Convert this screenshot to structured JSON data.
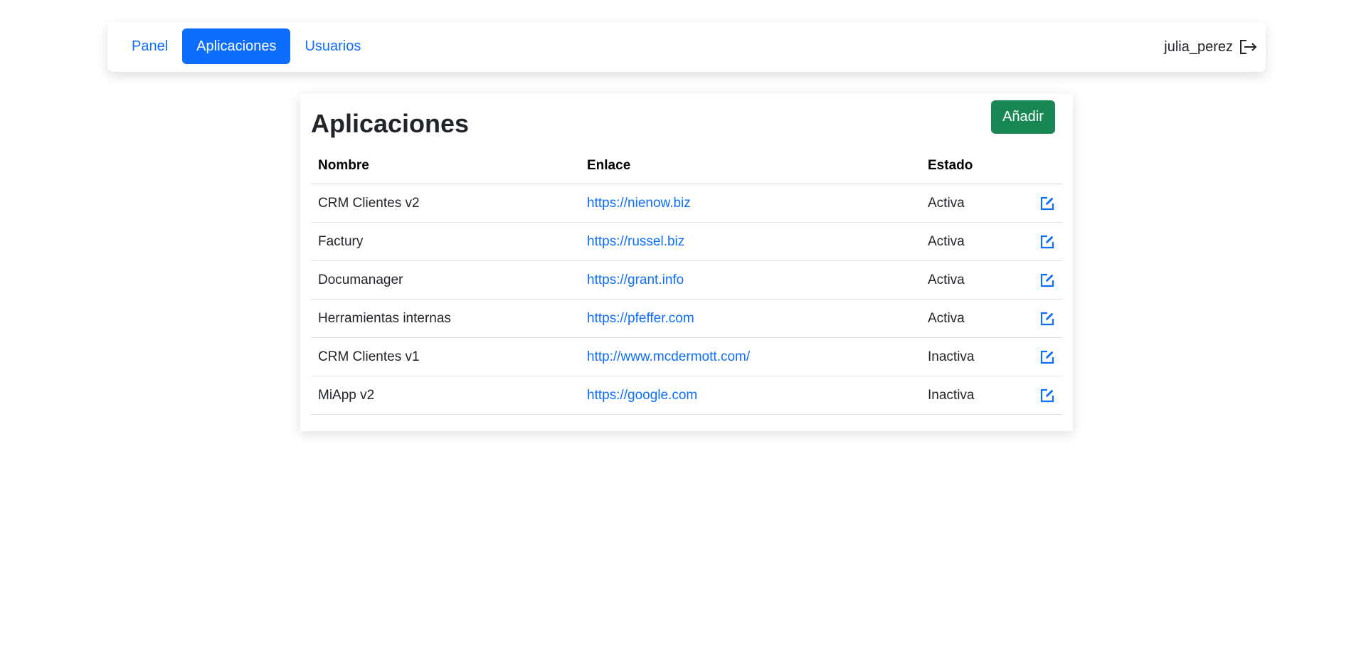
{
  "nav": {
    "items": [
      {
        "label": "Panel",
        "active": false
      },
      {
        "label": "Aplicaciones",
        "active": true
      },
      {
        "label": "Usuarios",
        "active": false
      }
    ],
    "username": "julia_perez",
    "logout_icon": "logout-icon"
  },
  "main": {
    "title": "Aplicaciones",
    "add_label": "Añadir",
    "columns": [
      "Nombre",
      "Enlace",
      "Estado",
      ""
    ],
    "rows": [
      {
        "name": "CRM Clientes v2",
        "link": "https://nienow.biz",
        "state": "Activa"
      },
      {
        "name": "Factury",
        "link": "https://russel.biz",
        "state": "Activa"
      },
      {
        "name": "Documanager",
        "link": "https://grant.info",
        "state": "Activa"
      },
      {
        "name": "Herramientas internas",
        "link": "https://pfeffer.com",
        "state": "Activa"
      },
      {
        "name": "CRM Clientes v1",
        "link": "http://www.mcdermott.com/",
        "state": "Inactiva"
      },
      {
        "name": "MiApp v2",
        "link": "https://google.com",
        "state": "Inactiva"
      }
    ],
    "row_action_icon": "edit-icon"
  },
  "colors": {
    "primary": "#0d6efd",
    "success": "#198754",
    "text": "#212529"
  }
}
